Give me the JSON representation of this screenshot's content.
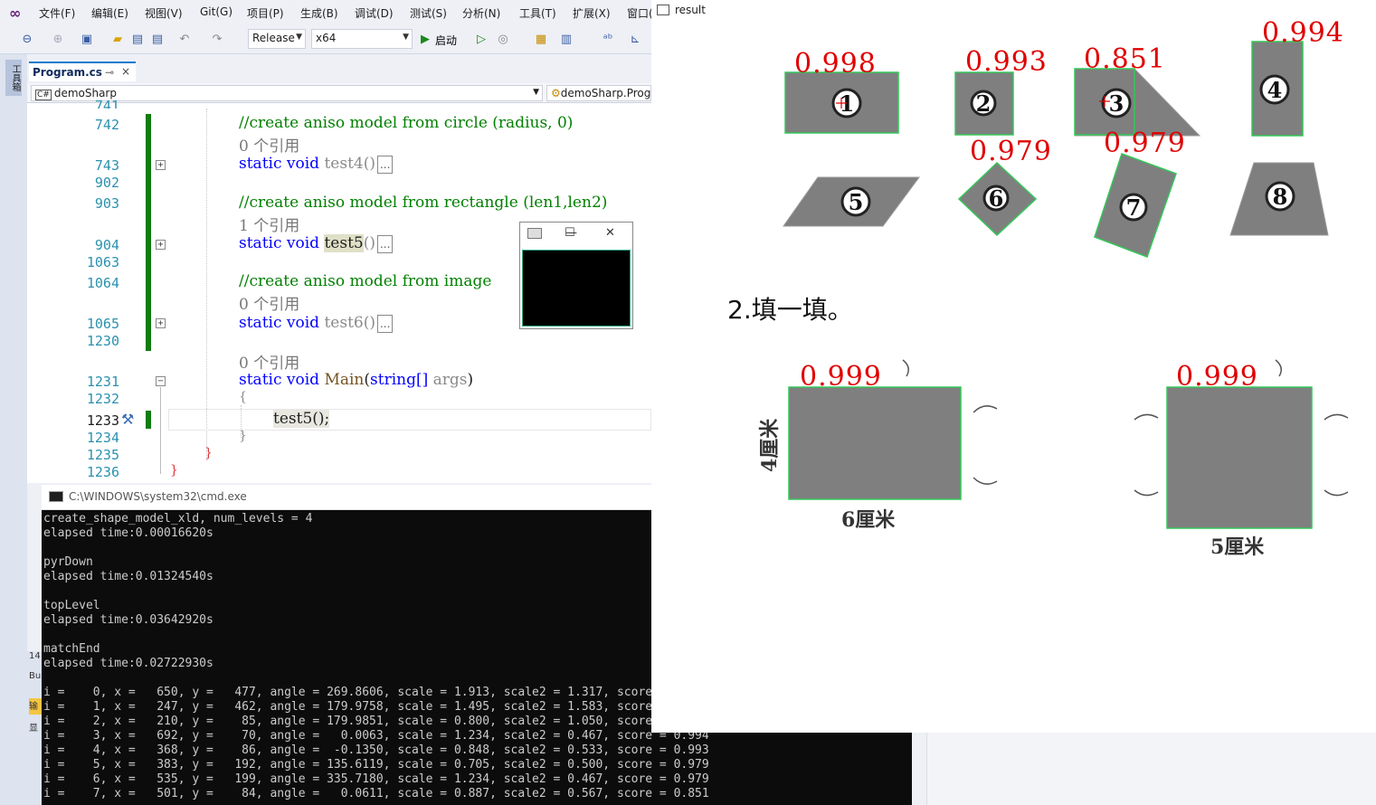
{
  "menu": [
    "文件(F)",
    "编辑(E)",
    "视图(V)",
    "Git(G)",
    "项目(P)",
    "生成(B)",
    "调试(D)",
    "测试(S)",
    "分析(N)",
    "工具(T)",
    "扩展(X)",
    "窗口("
  ],
  "toolbar": {
    "config": "Release",
    "platform": "x64",
    "start_label": "启动"
  },
  "leftstrip": {
    "toolbox": "工具箱"
  },
  "tab": {
    "name": "Program.cs",
    "pin": "⊸",
    "close": "×"
  },
  "nav": {
    "project": "demoSharp",
    "class": "demoSharp.Prog"
  },
  "editor": {
    "line_numbers": [
      "741",
      "742",
      "743",
      "902",
      "903",
      "904",
      "1063",
      "1064",
      "1065",
      "1230",
      "1231",
      "1232",
      "1233",
      "1234",
      "1235",
      "1236"
    ],
    "comment1": "//create aniso model from circle (radius, 0)",
    "ref0": "0 个引用",
    "ref1": "1 个引用",
    "static_void": "static void",
    "test4": "test4()",
    "comment2": "//create aniso model from rectangle (len1,len2)",
    "test5": "test5",
    "parens": "()",
    "comment3": "//create aniso model from image",
    "test6": "test6()",
    "main_sig_name": "Main",
    "main_sig_paren": "(",
    "main_sig_type": "string[]",
    "main_sig_arg": "args",
    "main_sig_close": ")",
    "brace_open": "{",
    "call_test5": "test5();",
    "brace_close": "}",
    "collapsed": "...",
    "fold_plus": "+",
    "fold_minus": "−"
  },
  "mini_window": {
    "min": "—",
    "max": "☐",
    "close": "✕"
  },
  "console": {
    "title": "C:\\WINDOWS\\system32\\cmd.exe",
    "lines": [
      "create_shape_model_xld, num_levels = 4",
      "elapsed time:0.00016620s",
      "",
      "pyrDown",
      "elapsed time:0.01324540s",
      "",
      "topLevel",
      "elapsed time:0.03642920s",
      "",
      "matchEnd",
      "elapsed time:0.02722930s",
      "",
      "i =    0, x =   650, y =   477, angle = 269.8606, scale = 1.913, scale2 = 1.317, score",
      "i =    1, x =   247, y =   462, angle = 179.9758, scale = 1.495, scale2 = 1.583, score",
      "i =    2, x =   210, y =    85, angle = 179.9851, scale = 0.800, scale2 = 1.050, score",
      "i =    3, x =   692, y =    70, angle =   0.0063, scale = 1.234, scale2 = 0.467, score = 0.994",
      "i =    4, x =   368, y =    86, angle =  -0.1350, scale = 0.848, scale2 = 0.533, score = 0.993",
      "i =    5, x =   383, y =   192, angle = 135.6119, scale = 0.705, scale2 = 0.500, score = 0.979",
      "i =    6, x =   535, y =   199, angle = 335.7180, scale = 1.234, scale2 = 0.467, score = 0.979",
      "i =    7, x =   501, y =    84, angle =   0.0611, scale = 0.887, scale2 = 0.567, score = 0.851"
    ]
  },
  "side_tags": [
    "14",
    "Bu",
    "输",
    "显"
  ],
  "result": {
    "title": "result",
    "scores": [
      "0.998",
      "0.993",
      "0.851",
      "0.994",
      "0.979",
      "0.979",
      "0.999",
      "0.999"
    ],
    "shape_numbers": [
      "1",
      "2",
      "3",
      "4",
      "5",
      "6",
      "7",
      "8"
    ],
    "heading": "2.填一填。",
    "dim_left_height": "4厘米",
    "dim_left_width": "6厘米",
    "dim_right_width": "5厘米"
  },
  "colors": {
    "accent": "#007acc",
    "score_red": "#e00000",
    "match_green": "#34c759",
    "shape_gray": "#7f7f7f"
  }
}
